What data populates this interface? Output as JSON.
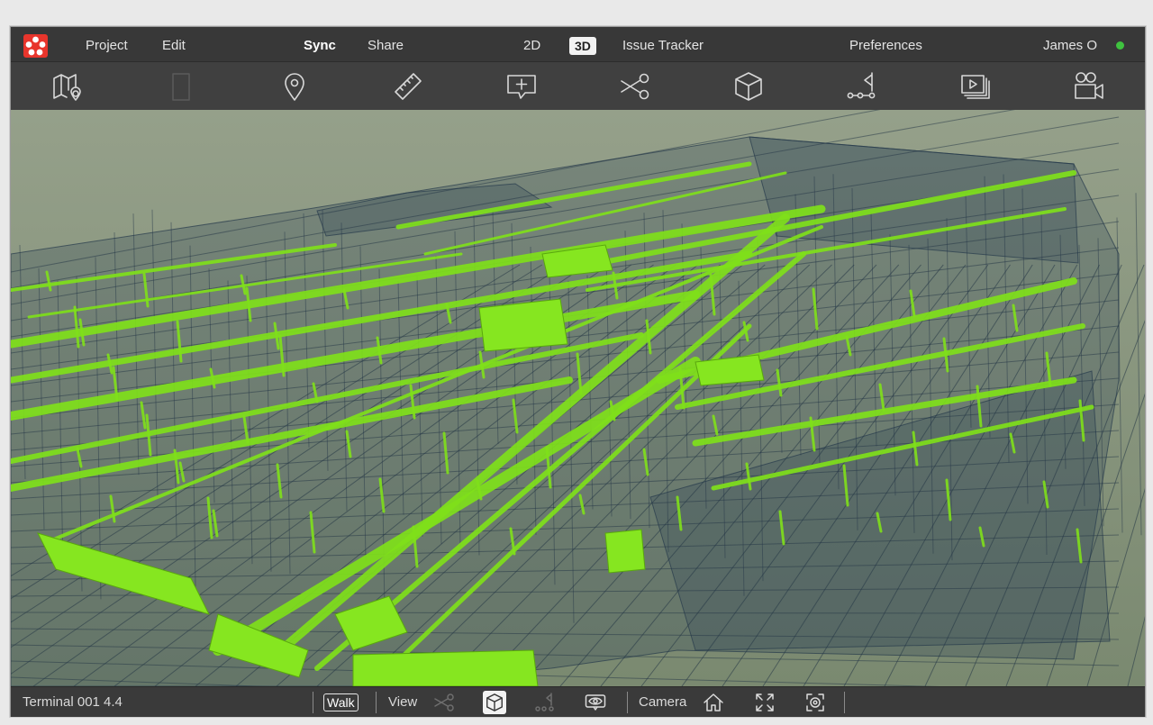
{
  "menubar": {
    "project": "Project",
    "edit": "Edit",
    "sync": "Sync",
    "share": "Share",
    "view_2d": "2D",
    "view_3d": "3D",
    "issue_tracker": "Issue Tracker",
    "preferences": "Preferences",
    "user_name": "James O",
    "status_color": "#3fc23f",
    "brand_color": "#e8352c"
  },
  "toolbar": {
    "icons": [
      "map-pin-icon",
      "door-icon",
      "location-pin-icon",
      "ruler-icon",
      "add-comment-icon",
      "scissors-icon",
      "cube-icon",
      "node-path-icon",
      "slideshow-icon",
      "camera-user-icon"
    ]
  },
  "viewport": {
    "model_color": "#7fe01a",
    "structure_color": "#2f4456"
  },
  "bottombar": {
    "model_name": "Terminal 001 4.4",
    "walk": "Walk",
    "view": "View",
    "camera": "Camera"
  }
}
